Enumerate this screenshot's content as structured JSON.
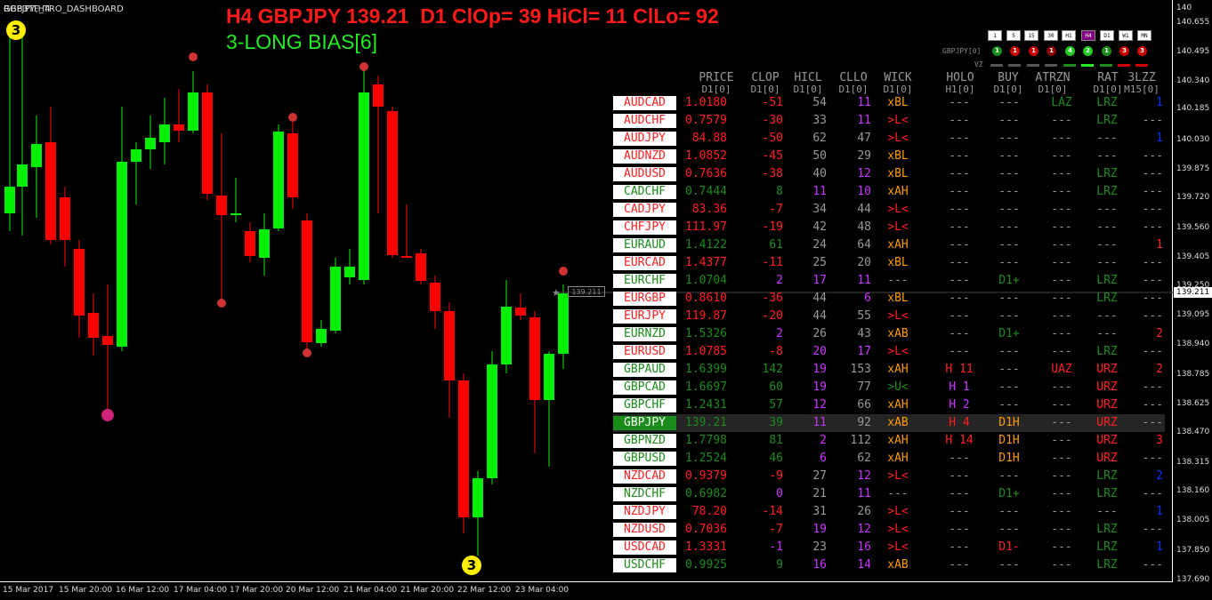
{
  "chart": {
    "symbol_title": "GBPJPY,H4",
    "indicator_name": "RGB3TF_TRO_DASHBOARD",
    "headline": "H4 GBPJPY 139.21  D1 ClOp= 39 HiCl= 11 ClLo= 92",
    "bias": "3-LONG BIAS[6]",
    "current_price": "139.211",
    "price_box_label": "139.211",
    "badge_top": "3",
    "badge_bottom": "3",
    "y_ticks": [
      "140",
      "140.655",
      "140.495",
      "140.340",
      "140.185",
      "140.030",
      "139.875",
      "139.720",
      "139.560",
      "139.405",
      "139.250",
      "139.095",
      "138.940",
      "138.785",
      "138.625",
      "138.470",
      "138.315",
      "138.160",
      "138.005",
      "137.850",
      "137.690"
    ],
    "x_ticks": [
      "15 Mar 2017",
      "15 Mar 20:00",
      "16 Mar 12:00",
      "17 Mar 04:00",
      "17 Mar 20:00",
      "20 Mar 12:00",
      "21 Mar 04:00",
      "21 Mar 20:00",
      "22 Mar 12:00",
      "23 Mar 04:00"
    ],
    "colors": {
      "bull": "#00ee00",
      "bear": "#ff0000"
    }
  },
  "timeframes": {
    "buttons": [
      "1",
      "5",
      "15",
      "30",
      "H1",
      "H4",
      "D1",
      "W1",
      "MN"
    ],
    "selected": "H4",
    "pair_label": "GBPJPY[0]",
    "vz_label": "VZ",
    "dots": [
      {
        "label": "1",
        "color": "#1a8c1a"
      },
      {
        "label": "1",
        "color": "#cc0000"
      },
      {
        "label": "1",
        "color": "#cc0000"
      },
      {
        "label": "1",
        "color": "#880000"
      },
      {
        "label": "4",
        "color": "#22cc22"
      },
      {
        "label": "2",
        "color": "#22cc22"
      },
      {
        "label": "1",
        "color": "#1a8c1a"
      },
      {
        "label": "3",
        "color": "#cc0000"
      },
      {
        "label": "3",
        "color": "#cc0000"
      }
    ],
    "bars": [
      "#555555",
      "#555555",
      "#555555",
      "#555555",
      "#1a8c1a",
      "#22ee22",
      "#1a8c1a",
      "#cc0000",
      "#cc0000"
    ]
  },
  "dashboard": {
    "columns": [
      {
        "name": "PRICE",
        "sub": "D1[0]"
      },
      {
        "name": "CLOP",
        "sub": "D1[0]"
      },
      {
        "name": "HICL",
        "sub": "D1[0]"
      },
      {
        "name": "CLLO",
        "sub": "D1[0]"
      },
      {
        "name": "WICK",
        "sub": "D1[0]"
      },
      {
        "name": "HOLO",
        "sub": "H1[0]"
      },
      {
        "name": "BUY",
        "sub": "D1[0]"
      },
      {
        "name": "ATRZN",
        "sub": "D1[0]"
      },
      {
        "name": "RAT",
        "sub": "D1[0]"
      },
      {
        "name": "3LZZ",
        "sub": "M15[0]"
      }
    ],
    "rows": [
      {
        "pair": "AUDCAD",
        "price": "1.0180",
        "clop": "-51",
        "hicl": "54",
        "cllo": "11",
        "wick": "xBL",
        "holo": "---",
        "buy": "---",
        "atrzn": "LAZ",
        "rat": "LRZ",
        "lzz": "1",
        "pc": "#ff2020",
        "clc": "#ff2020",
        "hc": "#999999",
        "lc": "#cc33ff",
        "wc": "#ff9900",
        "hoc": "#999999",
        "bc": "#999999",
        "ac": "#1a8c1a",
        "rc": "#1a8c1a",
        "zc": "#0033ff"
      },
      {
        "pair": "AUDCHF",
        "price": "0.7579",
        "clop": "-30",
        "hicl": "33",
        "cllo": "11",
        "wick": ">L<",
        "holo": "---",
        "buy": "---",
        "atrzn": "---",
        "rat": "LRZ",
        "lzz": "---",
        "pc": "#ff2020",
        "clc": "#ff2020",
        "hc": "#999999",
        "lc": "#cc33ff",
        "wc": "#ff2020",
        "hoc": "#999999",
        "bc": "#999999",
        "ac": "#999999",
        "rc": "#1a8c1a",
        "zc": "#999999"
      },
      {
        "pair": "AUDJPY",
        "price": "84.88",
        "clop": "-50",
        "hicl": "62",
        "cllo": "47",
        "wick": ">L<",
        "holo": "---",
        "buy": "---",
        "atrzn": "---",
        "rat": "---",
        "lzz": "1",
        "pc": "#ff2020",
        "clc": "#ff2020",
        "hc": "#999999",
        "lc": "#999999",
        "wc": "#ff2020",
        "hoc": "#999999",
        "bc": "#999999",
        "ac": "#999999",
        "rc": "#999999",
        "zc": "#0033ff"
      },
      {
        "pair": "AUDNZD",
        "price": "1.0852",
        "clop": "-45",
        "hicl": "50",
        "cllo": "29",
        "wick": "xBL",
        "holo": "---",
        "buy": "---",
        "atrzn": "---",
        "rat": "---",
        "lzz": "---",
        "pc": "#ff2020",
        "clc": "#ff2020",
        "hc": "#999999",
        "lc": "#999999",
        "wc": "#ff9900",
        "hoc": "#999999",
        "bc": "#999999",
        "ac": "#999999",
        "rc": "#999999",
        "zc": "#999999"
      },
      {
        "pair": "AUDUSD",
        "price": "0.7636",
        "clop": "-38",
        "hicl": "40",
        "cllo": "12",
        "wick": "xBL",
        "holo": "---",
        "buy": "---",
        "atrzn": "---",
        "rat": "LRZ",
        "lzz": "---",
        "pc": "#ff2020",
        "clc": "#ff2020",
        "hc": "#999999",
        "lc": "#cc33ff",
        "wc": "#ff9900",
        "hoc": "#999999",
        "bc": "#999999",
        "ac": "#999999",
        "rc": "#1a8c1a",
        "zc": "#999999"
      },
      {
        "pair": "CADCHF",
        "price": "0.7444",
        "clop": "8",
        "hicl": "11",
        "cllo": "10",
        "wick": "xAH",
        "holo": "---",
        "buy": "---",
        "atrzn": "---",
        "rat": "LRZ",
        "lzz": "---",
        "pc": "#1a8c1a",
        "clc": "#1a8c1a",
        "hc": "#cc33ff",
        "lc": "#cc33ff",
        "wc": "#ff9900",
        "hoc": "#999999",
        "bc": "#999999",
        "ac": "#999999",
        "rc": "#1a8c1a",
        "zc": "#999999"
      },
      {
        "pair": "CADJPY",
        "price": "83.36",
        "clop": "-7",
        "hicl": "34",
        "cllo": "44",
        "wick": ">L<",
        "holo": "---",
        "buy": "---",
        "atrzn": "---",
        "rat": "---",
        "lzz": "---",
        "pc": "#ff2020",
        "clc": "#ff2020",
        "hc": "#999999",
        "lc": "#999999",
        "wc": "#ff2020",
        "hoc": "#999999",
        "bc": "#999999",
        "ac": "#999999",
        "rc": "#999999",
        "zc": "#999999"
      },
      {
        "pair": "CHFJPY",
        "price": "111.97",
        "clop": "-19",
        "hicl": "42",
        "cllo": "48",
        "wick": ">L<",
        "holo": "---",
        "buy": "---",
        "atrzn": "---",
        "rat": "---",
        "lzz": "---",
        "pc": "#ff2020",
        "clc": "#ff2020",
        "hc": "#999999",
        "lc": "#999999",
        "wc": "#ff2020",
        "hoc": "#999999",
        "bc": "#999999",
        "ac": "#999999",
        "rc": "#999999",
        "zc": "#999999"
      },
      {
        "pair": "EURAUD",
        "price": "1.4122",
        "clop": "61",
        "hicl": "24",
        "cllo": "64",
        "wick": "xAH",
        "holo": "---",
        "buy": "---",
        "atrzn": "---",
        "rat": "---",
        "lzz": "1",
        "pc": "#1a8c1a",
        "clc": "#1a8c1a",
        "hc": "#999999",
        "lc": "#999999",
        "wc": "#ff9900",
        "hoc": "#999999",
        "bc": "#999999",
        "ac": "#999999",
        "rc": "#999999",
        "zc": "#ff2020"
      },
      {
        "pair": "EURCAD",
        "price": "1.4377",
        "clop": "-11",
        "hicl": "25",
        "cllo": "20",
        "wick": "xBL",
        "holo": "---",
        "buy": "---",
        "atrzn": "---",
        "rat": "---",
        "lzz": "---",
        "pc": "#ff2020",
        "clc": "#ff2020",
        "hc": "#999999",
        "lc": "#999999",
        "wc": "#ff9900",
        "hoc": "#999999",
        "bc": "#999999",
        "ac": "#999999",
        "rc": "#999999",
        "zc": "#999999"
      },
      {
        "pair": "EURCHF",
        "price": "1.0704",
        "clop": "2",
        "hicl": "17",
        "cllo": "11",
        "wick": "---",
        "holo": "---",
        "buy": "D1+",
        "atrzn": "---",
        "rat": "LRZ",
        "lzz": "---",
        "pc": "#1a8c1a",
        "clc": "#cc33ff",
        "hc": "#cc33ff",
        "lc": "#cc33ff",
        "wc": "#999999",
        "hoc": "#999999",
        "bc": "#1a8c1a",
        "ac": "#999999",
        "rc": "#1a8c1a",
        "zc": "#999999"
      },
      {
        "pair": "EURGBP",
        "price": "0.8610",
        "clop": "-36",
        "hicl": "44",
        "cllo": "6",
        "wick": "xBL",
        "holo": "---",
        "buy": "---",
        "atrzn": "---",
        "rat": "LRZ",
        "lzz": "---",
        "pc": "#ff2020",
        "clc": "#ff2020",
        "hc": "#999999",
        "lc": "#cc33ff",
        "wc": "#ff9900",
        "hoc": "#999999",
        "bc": "#999999",
        "ac": "#999999",
        "rc": "#1a8c1a",
        "zc": "#999999"
      },
      {
        "pair": "EURJPY",
        "price": "119.87",
        "clop": "-20",
        "hicl": "44",
        "cllo": "55",
        "wick": ">L<",
        "holo": "---",
        "buy": "---",
        "atrzn": "---",
        "rat": "---",
        "lzz": "---",
        "pc": "#ff2020",
        "clc": "#ff2020",
        "hc": "#999999",
        "lc": "#999999",
        "wc": "#ff2020",
        "hoc": "#999999",
        "bc": "#999999",
        "ac": "#999999",
        "rc": "#999999",
        "zc": "#999999"
      },
      {
        "pair": "EURNZD",
        "price": "1.5326",
        "clop": "2",
        "hicl": "26",
        "cllo": "43",
        "wick": "xAB",
        "holo": "---",
        "buy": "D1+",
        "atrzn": "---",
        "rat": "---",
        "lzz": "2",
        "pc": "#1a8c1a",
        "clc": "#cc33ff",
        "hc": "#999999",
        "lc": "#999999",
        "wc": "#ff9900",
        "hoc": "#999999",
        "bc": "#1a8c1a",
        "ac": "#999999",
        "rc": "#999999",
        "zc": "#ff2020"
      },
      {
        "pair": "EURUSD",
        "price": "1.0785",
        "clop": "-8",
        "hicl": "20",
        "cllo": "17",
        "wick": ">L<",
        "holo": "---",
        "buy": "---",
        "atrzn": "---",
        "rat": "LRZ",
        "lzz": "---",
        "pc": "#ff2020",
        "clc": "#ff2020",
        "hc": "#cc33ff",
        "lc": "#cc33ff",
        "wc": "#ff2020",
        "hoc": "#999999",
        "bc": "#999999",
        "ac": "#999999",
        "rc": "#1a8c1a",
        "zc": "#999999"
      },
      {
        "pair": "GBPAUD",
        "price": "1.6399",
        "clop": "142",
        "hicl": "19",
        "cllo": "153",
        "wick": "xAH",
        "holo": "H 11",
        "buy": "---",
        "atrzn": "UAZ",
        "rat": "URZ",
        "lzz": "2",
        "pc": "#1a8c1a",
        "clc": "#1a8c1a",
        "hc": "#cc33ff",
        "lc": "#999999",
        "wc": "#ff9900",
        "hoc": "#ff2020",
        "bc": "#999999",
        "ac": "#ff2020",
        "rc": "#ff2020",
        "zc": "#ff2020"
      },
      {
        "pair": "GBPCAD",
        "price": "1.6697",
        "clop": "60",
        "hicl": "19",
        "cllo": "77",
        "wick": ">U<",
        "holo": "H 1",
        "buy": "---",
        "atrzn": "---",
        "rat": "URZ",
        "lzz": "---",
        "pc": "#1a8c1a",
        "clc": "#1a8c1a",
        "hc": "#cc33ff",
        "lc": "#999999",
        "wc": "#1a8c1a",
        "hoc": "#cc33ff",
        "bc": "#999999",
        "ac": "#999999",
        "rc": "#ff2020",
        "zc": "#999999"
      },
      {
        "pair": "GBPCHF",
        "price": "1.2431",
        "clop": "57",
        "hicl": "12",
        "cllo": "66",
        "wick": "xAH",
        "holo": "H 2",
        "buy": "---",
        "atrzn": "---",
        "rat": "URZ",
        "lzz": "---",
        "pc": "#1a8c1a",
        "clc": "#1a8c1a",
        "hc": "#cc33ff",
        "lc": "#999999",
        "wc": "#ff9900",
        "hoc": "#cc33ff",
        "bc": "#999999",
        "ac": "#999999",
        "rc": "#ff2020",
        "zc": "#999999"
      },
      {
        "pair": "GBPJPY",
        "price": "139.21",
        "clop": "39",
        "hicl": "11",
        "cllo": "92",
        "wick": "xAB",
        "holo": "H 4",
        "buy": "D1H",
        "atrzn": "---",
        "rat": "URZ",
        "lzz": "---",
        "pc": "#1a8c1a",
        "clc": "#1a8c1a",
        "hc": "#cc33ff",
        "lc": "#999999",
        "wc": "#ff9900",
        "hoc": "#ff2020",
        "bc": "#ff9900",
        "ac": "#999999",
        "rc": "#ff2020",
        "zc": "#999999",
        "selected": true
      },
      {
        "pair": "GBPNZD",
        "price": "1.7798",
        "clop": "81",
        "hicl": "2",
        "cllo": "112",
        "wick": "xAH",
        "holo": "H 14",
        "buy": "D1H",
        "atrzn": "---",
        "rat": "URZ",
        "lzz": "3",
        "pc": "#1a8c1a",
        "clc": "#1a8c1a",
        "hc": "#cc33ff",
        "lc": "#999999",
        "wc": "#ff9900",
        "hoc": "#ff2020",
        "bc": "#ff9900",
        "ac": "#999999",
        "rc": "#ff2020",
        "zc": "#ff2020"
      },
      {
        "pair": "GBPUSD",
        "price": "1.2524",
        "clop": "46",
        "hicl": "6",
        "cllo": "62",
        "wick": "xAH",
        "holo": "---",
        "buy": "D1H",
        "atrzn": "---",
        "rat": "URZ",
        "lzz": "---",
        "pc": "#1a8c1a",
        "clc": "#1a8c1a",
        "hc": "#cc33ff",
        "lc": "#999999",
        "wc": "#ff9900",
        "hoc": "#999999",
        "bc": "#ff9900",
        "ac": "#999999",
        "rc": "#ff2020",
        "zc": "#999999"
      },
      {
        "pair": "NZDCAD",
        "price": "0.9379",
        "clop": "-9",
        "hicl": "27",
        "cllo": "12",
        "wick": ">L<",
        "holo": "---",
        "buy": "---",
        "atrzn": "---",
        "rat": "LRZ",
        "lzz": "2",
        "pc": "#ff2020",
        "clc": "#ff2020",
        "hc": "#999999",
        "lc": "#cc33ff",
        "wc": "#ff2020",
        "hoc": "#999999",
        "bc": "#999999",
        "ac": "#999999",
        "rc": "#1a8c1a",
        "zc": "#0033ff"
      },
      {
        "pair": "NZDCHF",
        "price": "0.6982",
        "clop": "0",
        "hicl": "21",
        "cllo": "11",
        "wick": "---",
        "holo": "---",
        "buy": "D1+",
        "atrzn": "---",
        "rat": "LRZ",
        "lzz": "---",
        "pc": "#1a8c1a",
        "clc": "#cc33ff",
        "hc": "#999999",
        "lc": "#cc33ff",
        "wc": "#999999",
        "hoc": "#999999",
        "bc": "#1a8c1a",
        "ac": "#999999",
        "rc": "#1a8c1a",
        "zc": "#999999"
      },
      {
        "pair": "NZDJPY",
        "price": "78.20",
        "clop": "-14",
        "hicl": "31",
        "cllo": "26",
        "wick": ">L<",
        "holo": "---",
        "buy": "---",
        "atrzn": "---",
        "rat": "---",
        "lzz": "1",
        "pc": "#ff2020",
        "clc": "#ff2020",
        "hc": "#999999",
        "lc": "#999999",
        "wc": "#ff2020",
        "hoc": "#999999",
        "bc": "#999999",
        "ac": "#999999",
        "rc": "#999999",
        "zc": "#0033ff"
      },
      {
        "pair": "NZDUSD",
        "price": "0.7036",
        "clop": "-7",
        "hicl": "19",
        "cllo": "12",
        "wick": ">L<",
        "holo": "---",
        "buy": "---",
        "atrzn": "---",
        "rat": "LRZ",
        "lzz": "---",
        "pc": "#ff2020",
        "clc": "#ff2020",
        "hc": "#cc33ff",
        "lc": "#cc33ff",
        "wc": "#ff2020",
        "hoc": "#999999",
        "bc": "#999999",
        "ac": "#999999",
        "rc": "#1a8c1a",
        "zc": "#999999"
      },
      {
        "pair": "USDCAD",
        "price": "1.3331",
        "clop": "-1",
        "hicl": "23",
        "cllo": "16",
        "wick": ">L<",
        "holo": "---",
        "buy": "D1-",
        "atrzn": "---",
        "rat": "LRZ",
        "lzz": "1",
        "pc": "#ff2020",
        "clc": "#cc33ff",
        "hc": "#999999",
        "lc": "#cc33ff",
        "wc": "#ff2020",
        "hoc": "#999999",
        "bc": "#ff2020",
        "ac": "#999999",
        "rc": "#1a8c1a",
        "zc": "#0033ff"
      },
      {
        "pair": "USDCHF",
        "price": "0.9925",
        "clop": "9",
        "hicl": "16",
        "cllo": "14",
        "wick": "xAB",
        "holo": "---",
        "buy": "---",
        "atrzn": "---",
        "rat": "LRZ",
        "lzz": "---",
        "pc": "#1a8c1a",
        "clc": "#1a8c1a",
        "hc": "#cc33ff",
        "lc": "#cc33ff",
        "wc": "#ff9900",
        "hoc": "#999999",
        "bc": "#999999",
        "ac": "#999999",
        "rc": "#1a8c1a",
        "zc": "#999999"
      }
    ]
  }
}
